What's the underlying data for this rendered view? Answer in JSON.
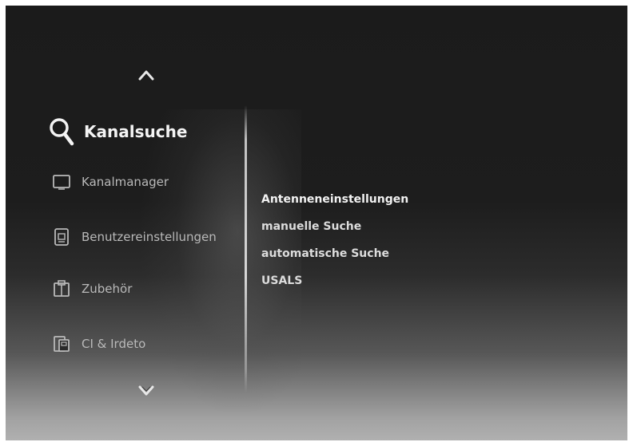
{
  "menu": {
    "items": [
      {
        "label": "Kanalsuche",
        "icon": "search-icon",
        "active": true
      },
      {
        "label": "Kanalmanager",
        "icon": "tv-icon",
        "active": false
      },
      {
        "label": "Benutzereinstellungen",
        "icon": "settings-panel-icon",
        "active": false
      },
      {
        "label": "Zubehör",
        "icon": "accessory-icon",
        "active": false
      },
      {
        "label": "CI & Irdeto",
        "icon": "card-icon",
        "active": false
      }
    ],
    "scroll_up_icon": "chevron-up-icon",
    "scroll_down_icon": "chevron-down-icon"
  },
  "submenu": {
    "items": [
      {
        "label": "Antenneneinstellungen"
      },
      {
        "label": "manuelle Suche"
      },
      {
        "label": "automatische Suche"
      },
      {
        "label": "USALS"
      }
    ]
  },
  "colors": {
    "text_active": "#f4f4f4",
    "text_inactive": "#b9b9b9",
    "background_top": "#1b1b1b",
    "background_bottom": "#b0b0b0"
  }
}
